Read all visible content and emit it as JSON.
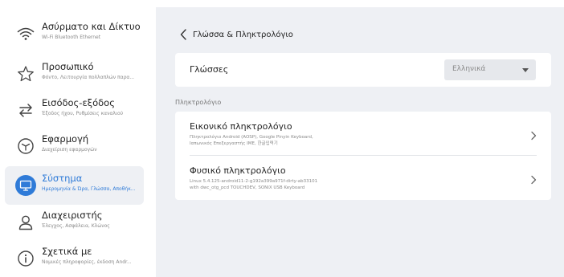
{
  "sidebar": {
    "items": [
      {
        "title": "Ασύρματο και Δίκτυο",
        "subtitle": "Wi-Fi Bluetooth Ethernet",
        "icon": "wifi-icon"
      },
      {
        "title": "Προσωπικό",
        "subtitle": "Φόντο, Λειτουργία πολλαπλών παρα...",
        "icon": "star-icon"
      },
      {
        "title": "Εισόδος-εξόδος",
        "subtitle": "Έξοδος ήχου, Ρυθμίσεις καναλιού",
        "icon": "swap-arrows-icon"
      },
      {
        "title": "Εφαρμογή",
        "subtitle": "Διαχείριση εφαρμογών",
        "icon": "app-cube-icon"
      },
      {
        "title": "Σύστημα",
        "subtitle": "Ημερομηνία & Ώρα, Γλώσσα, Αποθήκ...",
        "icon": "monitor-icon",
        "active": true
      },
      {
        "title": "Διαχειριστής",
        "subtitle": "Έλεγχος, Ασφάλεια, Κλώνος",
        "icon": "user-icon"
      },
      {
        "title": "Σχετικά με",
        "subtitle": "Νομικές πληροφορίες, έκδοση Andr...",
        "icon": "info-icon"
      }
    ]
  },
  "header": {
    "title": "Γλώσσα & Πληκτρολόγιο"
  },
  "languages": {
    "label": "Γλώσσες",
    "selected": "Ελληνικά"
  },
  "keyboard_section": {
    "label": "Πληκτρολόγιο"
  },
  "keyboards": [
    {
      "title": "Εικονικό πληκτρολόγιο",
      "subtitle_line1": "Πληκτρολόγιο Android (AOSP), Google Pinyin Keyboard,",
      "subtitle_line2": "Ιαπωνικός Επεξεργαστής IME, 한글입력기"
    },
    {
      "title": "Φυσικό πληκτρολόγιο",
      "subtitle_line1": "Linux 5.4.125-android11-2-g192a399a971f-dirty-ab33101",
      "subtitle_line2": "with dwc_otg_pcd TOUCHDEV, SONiX USB Keyboard"
    }
  ],
  "colors": {
    "accent": "#2f7bd8",
    "main_background": "#eef0f4",
    "card": "#ffffff"
  }
}
